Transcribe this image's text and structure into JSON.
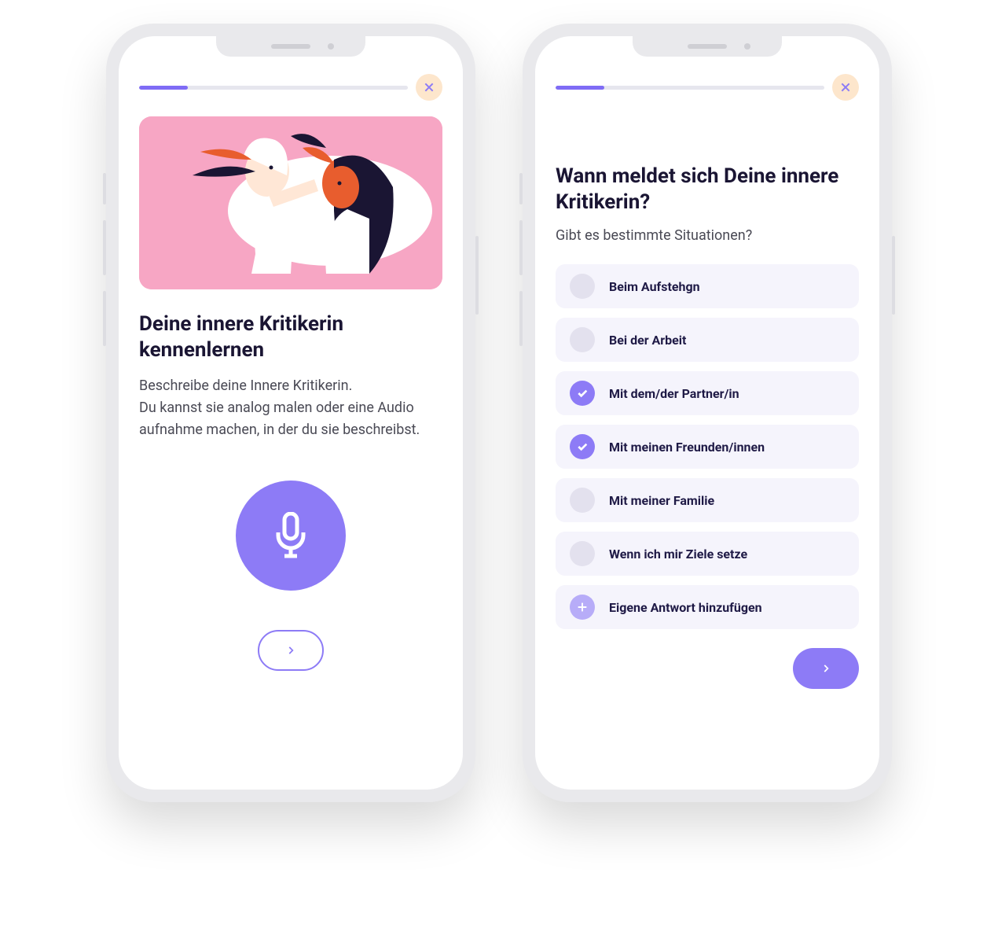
{
  "colors": {
    "accent": "#8d7bf6",
    "accent_light": "#b7acf8",
    "close_bg": "#fde6cc",
    "option_bg": "#f5f4fc",
    "circle_off": "#e3e1ee",
    "text_dark": "#1a1533",
    "illus_bg": "#f7a6c4"
  },
  "screen1": {
    "progress_pct": 18,
    "heading": "Deine innere Kritikerin kennenlernen",
    "body": "Beschreibe deine Innere Kritikerin.\nDu kannst sie analog malen oder eine Audio aufnahme machen, in der du sie beschreibst."
  },
  "screen2": {
    "progress_pct": 18,
    "heading": "Wann meldet sich Deine innere Kritikerin?",
    "subhead": "Gibt es bestimmte Situationen?",
    "options": [
      {
        "label": "Beim Aufstehgn",
        "selected": false,
        "type": "item"
      },
      {
        "label": "Bei der Arbeit",
        "selected": false,
        "type": "item"
      },
      {
        "label": "Mit dem/der Partner/in",
        "selected": true,
        "type": "item"
      },
      {
        "label": "Mit meinen Freunden/innen",
        "selected": true,
        "type": "item"
      },
      {
        "label": "Mit meiner Familie",
        "selected": false,
        "type": "item"
      },
      {
        "label": "Wenn ich mir Ziele setze",
        "selected": false,
        "type": "item"
      },
      {
        "label": "Eigene Antwort hinzufügen",
        "selected": false,
        "type": "add"
      }
    ]
  }
}
